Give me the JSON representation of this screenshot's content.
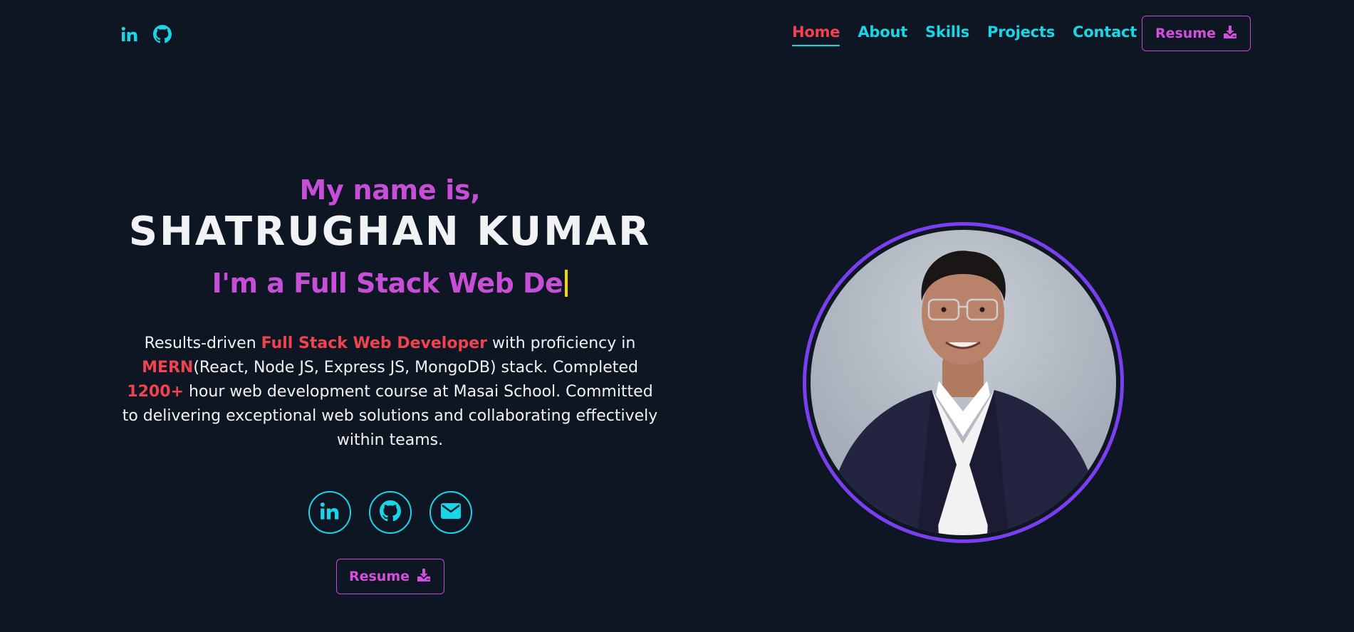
{
  "nav": {
    "links": [
      {
        "label": "Home",
        "active": true
      },
      {
        "label": "About",
        "active": false
      },
      {
        "label": "Skills",
        "active": false
      },
      {
        "label": "Projects",
        "active": false
      },
      {
        "label": "Contact",
        "active": false
      }
    ],
    "resume_label": "Resume",
    "social_icons": [
      "linkedin-icon",
      "github-icon"
    ]
  },
  "hero": {
    "intro": "My name is,",
    "name": "SHATRUGHAN KUMAR",
    "typed_text": "I'm a Full Stack Web De",
    "bio": {
      "p1": "Results-driven ",
      "hl1": "Full Stack Web Developer",
      "p2": " with proficiency in ",
      "hl2": "MERN",
      "p3": "(React, Node JS, Express JS, MongoDB) stack. Completed ",
      "hl3": "1200+",
      "p4": " hour web development course at Masai School. Committed to delivering exceptional web solutions and collaborating effectively within teams."
    },
    "social_icons": [
      "linkedin-icon",
      "github-icon",
      "envelope-icon"
    ],
    "resume_label": "Resume"
  },
  "colors": {
    "background": "#0f1623",
    "accent_cyan": "#18d6e6",
    "accent_red": "#f0424f",
    "accent_magenta": "#c74ed6",
    "ring_purple": "#7b3ff2",
    "caret_yellow": "#f5d600"
  }
}
